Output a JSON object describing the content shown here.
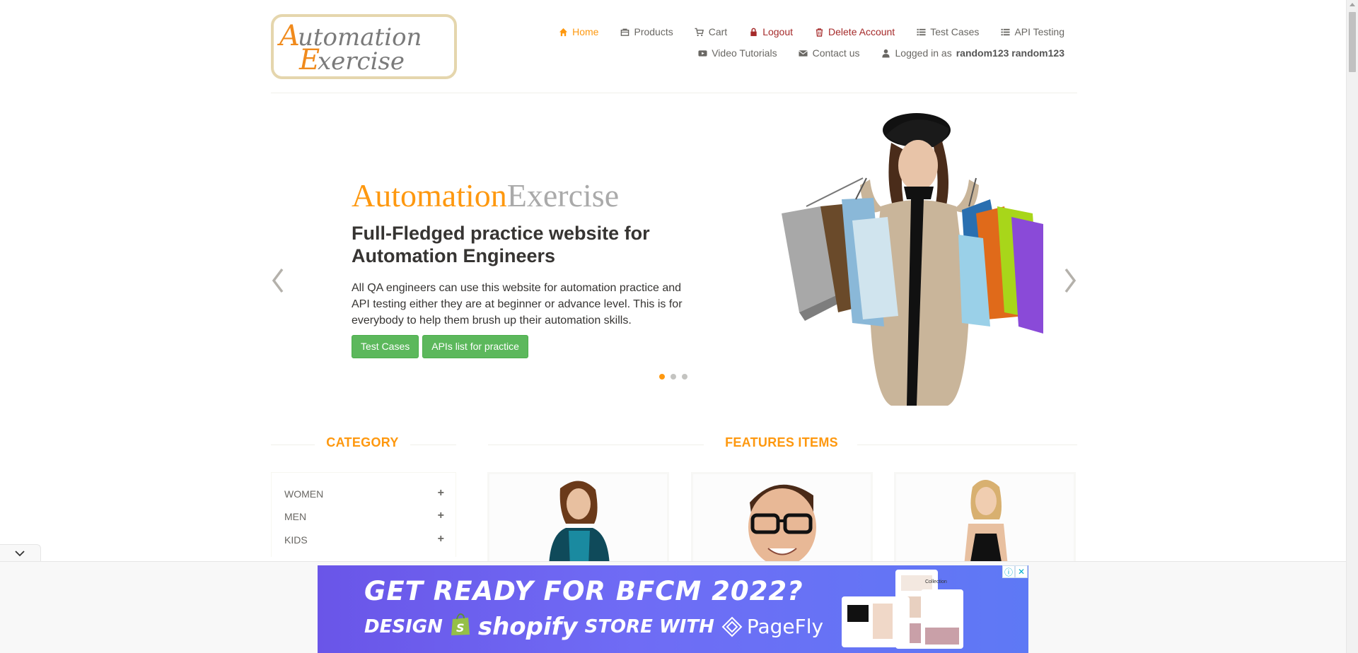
{
  "logo": {
    "line1": "Automation",
    "line2": "Exercise"
  },
  "nav": {
    "row1": [
      {
        "key": "home",
        "label": "Home",
        "icon": "home-icon"
      },
      {
        "key": "products",
        "label": "Products",
        "icon": "shopping-bag-icon"
      },
      {
        "key": "cart",
        "label": "Cart",
        "icon": "cart-icon"
      },
      {
        "key": "logout",
        "label": "Logout",
        "icon": "lock-icon"
      },
      {
        "key": "delete",
        "label": "Delete Account",
        "icon": "trash-icon"
      },
      {
        "key": "testcases",
        "label": "Test Cases",
        "icon": "list-icon"
      },
      {
        "key": "api",
        "label": "API Testing",
        "icon": "list-icon"
      }
    ],
    "row2": [
      {
        "key": "video",
        "label": "Video Tutorials",
        "icon": "youtube-icon"
      },
      {
        "key": "contact",
        "label": "Contact us",
        "icon": "envelope-icon"
      }
    ],
    "logged_in_prefix": "Logged in as",
    "logged_in_user": "random123 random123"
  },
  "slider": {
    "brand_part1": "Automation",
    "brand_part2": "Exercise",
    "heading": "Full-Fledged practice website for Automation Engineers",
    "description": "All QA engineers can use this website for automation practice and API testing either they are at beginner or advance level. This is for everybody to help them brush up their automation skills.",
    "button_test_cases": "Test Cases",
    "button_apis": "APIs list for practice",
    "active_slide": 1,
    "slide_count": 3
  },
  "category": {
    "title": "CATEGORY",
    "items": [
      "WOMEN",
      "MEN",
      "KIDS"
    ]
  },
  "features": {
    "title": "FEATURES ITEMS"
  },
  "ad": {
    "line1": "GET READY FOR BFCM 2022?",
    "line2_prefix": "DESIGN",
    "line2_brand": "shopify",
    "line2_suffix": "STORE WITH",
    "line2_partner": "PageFly",
    "mock_caption": "Collection"
  },
  "colors": {
    "accent": "#fe980f",
    "danger": "#a52a2a",
    "button_green": "#5cb85c",
    "text": "#696763"
  }
}
